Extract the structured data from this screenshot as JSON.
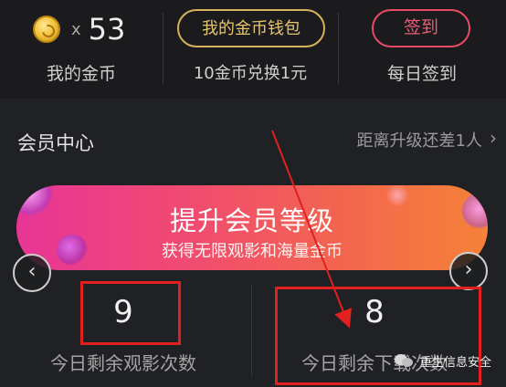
{
  "stats_bar": {
    "coin_icon": "gold-coin-icon",
    "coin_times": "x",
    "coin_count": "53",
    "coin_label": "我的金币",
    "wallet_button": "我的金币钱包",
    "exchange_label": "10金币兑换1元",
    "sign_button": "签到",
    "sign_label": "每日签到"
  },
  "member": {
    "title": "会员中心",
    "upgrade_hint": "距离升级还差1人",
    "hint_icon": "chevron-right-icon",
    "banner_title": "提升会员等级",
    "banner_subtitle": "获得无限观影和海量金币",
    "prev_icon": "chevron-left-icon",
    "next_icon": "chevron-right-icon"
  },
  "counters": [
    {
      "value": "9",
      "label": "今日剩余观影次数"
    },
    {
      "value": "8",
      "label": "今日剩余下载次数"
    }
  ],
  "annotations": {
    "box_color": "#e0211f",
    "arrow_color": "#e0211f"
  },
  "watermark": {
    "text": "重生信息安全",
    "icon": "wechat-icon"
  },
  "colors": {
    "background": "#202124",
    "wallet_gold": "#d7b25a",
    "sign_red": "#e94a64",
    "banner_start": "#e73597",
    "banner_end": "#f58238"
  }
}
